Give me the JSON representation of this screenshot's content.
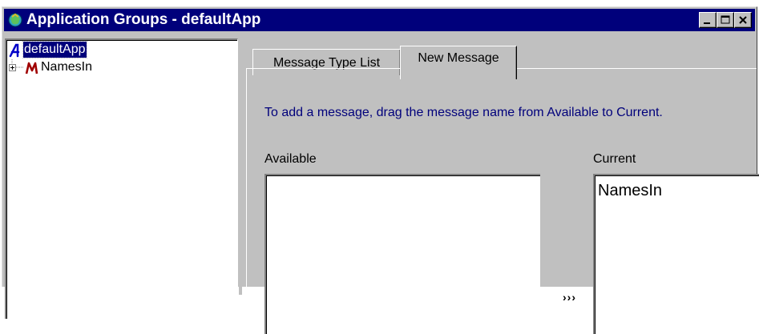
{
  "window": {
    "title": "Application Groups - defaultApp",
    "icon": "application-groups-icon",
    "buttons": [
      "minimize",
      "maximize",
      "close"
    ]
  },
  "tree": {
    "root": {
      "label": "defaultApp",
      "icon": "A-app-icon",
      "selected": true
    },
    "children": [
      {
        "label": "NamesIn",
        "icon": "M-message-icon",
        "expander": "plus-icon"
      }
    ]
  },
  "tabs": [
    {
      "label": "Message Type List",
      "active": false
    },
    {
      "label": "New Message",
      "active": true
    }
  ],
  "new_message": {
    "instruction": "To add a message, drag the message name from Available to Current.",
    "available_label": "Available",
    "current_label": "Current",
    "available_items": [],
    "current_items": [
      "NamesIn"
    ],
    "move_button": "›››"
  },
  "colors": {
    "face": "#c0c0c0",
    "title_bar": "#00007b",
    "instruction_text": "#00007b",
    "selection": "#00007b"
  }
}
